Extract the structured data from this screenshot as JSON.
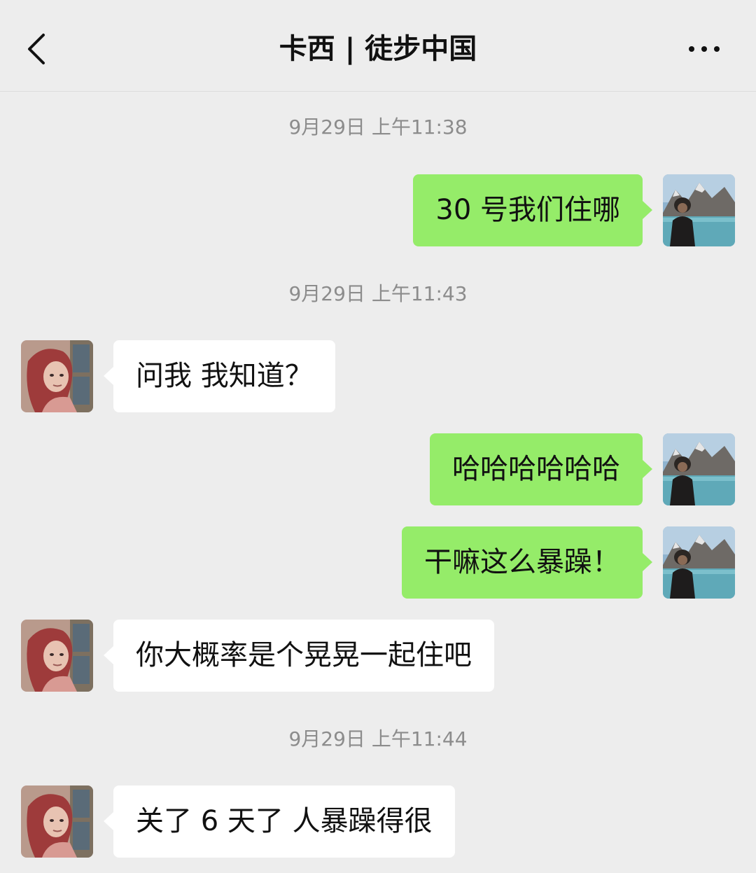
{
  "header": {
    "title": "卡西 | 徒步中国",
    "back_icon": "chevron-left-icon",
    "more_icon": "more-horizontal-icon"
  },
  "chat": {
    "timestamps": [
      "9月29日 上午11:38",
      "9月29日 上午11:43",
      "9月29日 上午11:44"
    ],
    "messages": [
      {
        "direction": "outgoing",
        "text": "30 号我们住哪"
      },
      {
        "direction": "incoming",
        "text": "问我 我知道？"
      },
      {
        "direction": "outgoing",
        "text": "哈哈哈哈哈哈"
      },
      {
        "direction": "outgoing",
        "text": "干嘛这么暴躁！"
      },
      {
        "direction": "incoming",
        "text": "你大概率是个晃晃一起住吧"
      },
      {
        "direction": "incoming",
        "text": "关了 6 天了 人暴躁得很"
      }
    ]
  },
  "colors": {
    "background": "#ededed",
    "outgoing_bubble": "#95ec69",
    "incoming_bubble": "#ffffff"
  }
}
